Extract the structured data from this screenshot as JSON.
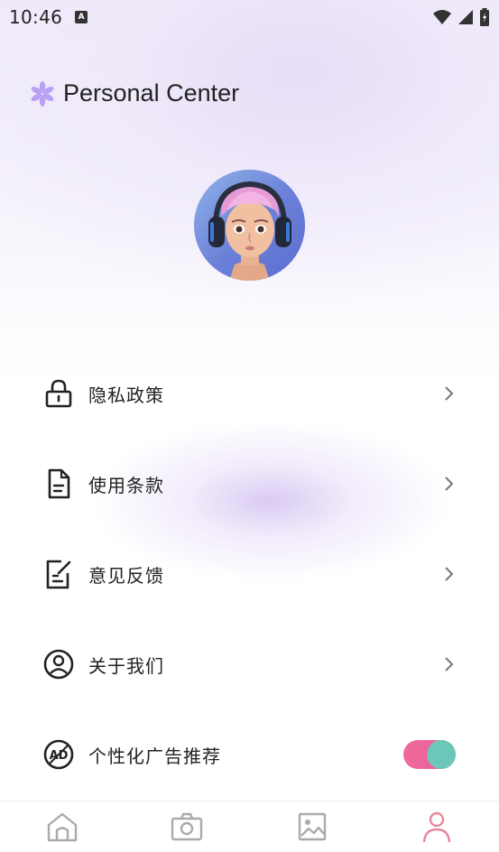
{
  "status_bar": {
    "time": "10:46",
    "notification_icon": "a-icon",
    "wifi_icon": "wifi-icon",
    "signal_icon": "signal-icon",
    "battery_icon": "battery-icon"
  },
  "header": {
    "icon": "asterisk-icon",
    "title": "Personal Center",
    "accent_color": "#a78bfa"
  },
  "avatar": {
    "icon": "user-avatar"
  },
  "menu": {
    "items": [
      {
        "label": "隐私政策",
        "icon": "lock-icon"
      },
      {
        "label": "使用条款",
        "icon": "document-icon"
      },
      {
        "label": "意见反馈",
        "icon": "edit-icon"
      },
      {
        "label": "关于我们",
        "icon": "user-circle-icon"
      },
      {
        "label": "个性化广告推荐",
        "icon": "ad-icon",
        "toggle_on": true
      }
    ]
  },
  "tabbar": {
    "tabs": [
      {
        "icon": "home-icon",
        "active": false
      },
      {
        "icon": "camera-icon",
        "active": false
      },
      {
        "icon": "image-icon",
        "active": false
      },
      {
        "icon": "profile-icon",
        "active": true
      }
    ],
    "active_color": "#e8879a",
    "inactive_color": "#aaaaaa"
  }
}
